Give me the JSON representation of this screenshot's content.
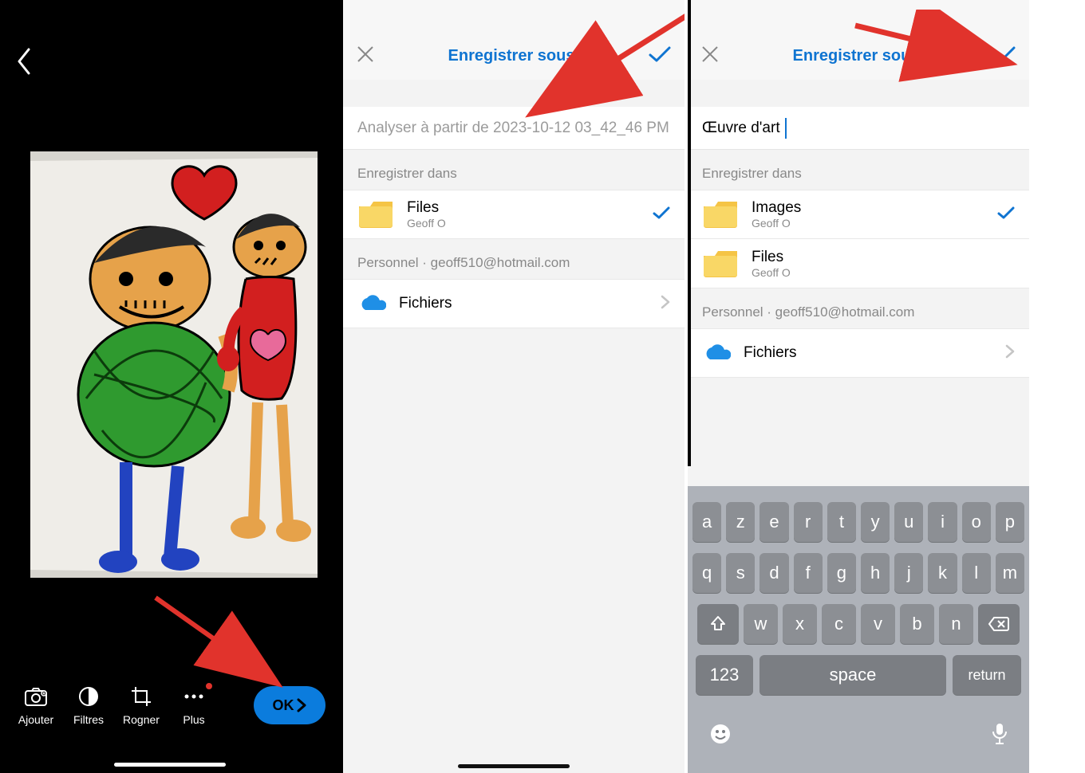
{
  "panel1": {
    "toolbar": {
      "add": "Ajouter",
      "filters": "Filtres",
      "crop": "Rogner",
      "more": "Plus",
      "ok": "OK"
    }
  },
  "panel2": {
    "title": "Enregistrer sous",
    "filename": "Analyser à partir de 2023-10-12 03_42_46 PM",
    "save_in_label": "Enregistrer dans",
    "folder_name": "Files",
    "folder_owner": "Geoff O",
    "account_label": "Personnel · geoff510@hotmail.com",
    "files_root": "Fichiers"
  },
  "panel3": {
    "title": "Enregistrer sous",
    "filename": "Œuvre d'art",
    "save_in_label": "Enregistrer dans",
    "images_name": "Images",
    "images_owner": "Geoff O",
    "files_name": "Files",
    "files_owner": "Geoff O",
    "account_label": "Personnel · geoff510@hotmail.com",
    "files_root": "Fichiers",
    "keyboard": {
      "row1": [
        "a",
        "z",
        "e",
        "r",
        "t",
        "y",
        "u",
        "i",
        "o",
        "p"
      ],
      "row2": [
        "q",
        "s",
        "d",
        "f",
        "g",
        "h",
        "j",
        "k",
        "l",
        "m"
      ],
      "row3": [
        "w",
        "x",
        "c",
        "v",
        "b",
        "n"
      ],
      "k123": "123",
      "space": "space",
      "return": "return"
    }
  }
}
